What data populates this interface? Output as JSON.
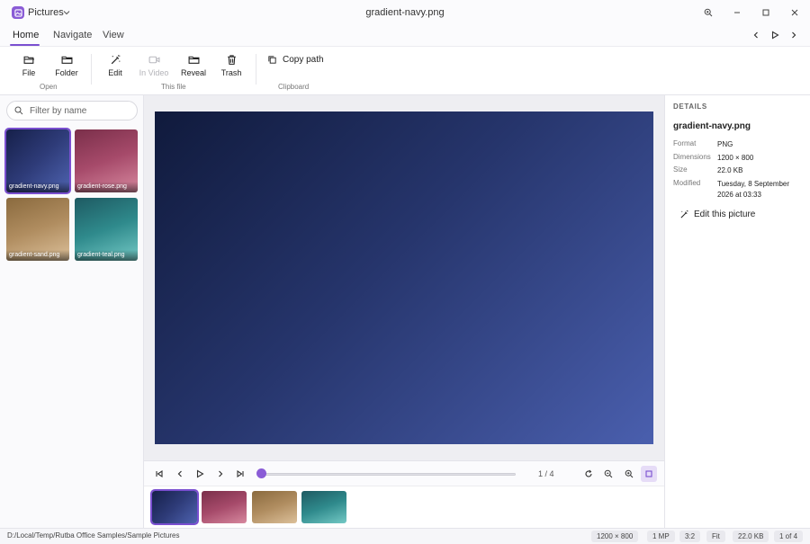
{
  "app": {
    "name": "Pictures",
    "window_title": "gradient-navy.png"
  },
  "tabs": [
    {
      "label": "Home",
      "active": true
    },
    {
      "label": "Navigate",
      "active": false
    },
    {
      "label": "View",
      "active": false
    }
  ],
  "ribbon": {
    "open_group": "Open",
    "file_label": "File",
    "folder_label": "Folder",
    "this_file_group": "This file",
    "edit_label": "Edit",
    "in_video_label": "In Video",
    "reveal_label": "Reveal",
    "trash_label": "Trash",
    "clipboard_group": "Clipboard",
    "copy_path_label": "Copy path"
  },
  "sidebar": {
    "filter_placeholder": "Filter by name",
    "thumbnails": [
      {
        "name": "gradient-navy.png",
        "selected": true
      },
      {
        "name": "gradient-rose.png",
        "selected": false
      },
      {
        "name": "gradient-sand.png",
        "selected": false
      },
      {
        "name": "gradient-teal.png",
        "selected": false
      }
    ]
  },
  "viewer": {
    "counter": "1 / 4",
    "scrub_position": 0
  },
  "details": {
    "heading": "DETAILS",
    "filename": "gradient-navy.png",
    "format_label": "Format",
    "format": "PNG",
    "dimensions_label": "Dimensions",
    "dimensions": "1200 × 800",
    "size_label": "Size",
    "size": "22.0 KB",
    "modified_label": "Modified",
    "modified_line1": "Tuesday, 8 September",
    "modified_line2": "2026 at 03:33",
    "edit_link": "Edit this picture"
  },
  "status": {
    "path": "D:/Local/Temp/Rutba Office Samples/Sample Pictures",
    "dimensions": "1200 × 800",
    "megapixels": "1 MP",
    "aspect": "3:2",
    "zoom": "Fit",
    "size": "22.0 KB",
    "position": "1 of 4"
  },
  "colors": {
    "accent": "#7a4fd0",
    "navy": "#26356c",
    "rose": "#a64a6a",
    "sand": "#b08d60",
    "teal": "#2f8a8c"
  }
}
